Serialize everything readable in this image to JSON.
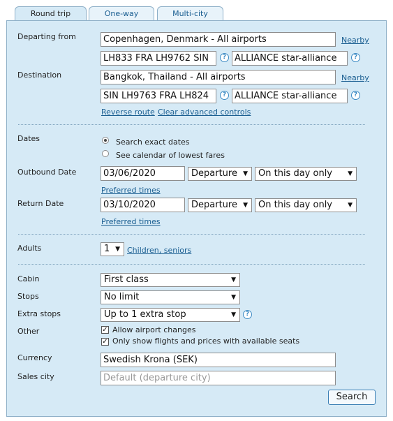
{
  "tabs": [
    {
      "label": "Round trip",
      "active": true
    },
    {
      "label": "One-way",
      "active": false
    },
    {
      "label": "Multi-city",
      "active": false
    }
  ],
  "departing": {
    "label": "Departing from",
    "value": "Copenhagen, Denmark - All airports",
    "nearby": "Nearby",
    "routing": "LH833 FRA LH9762 SIN",
    "extension": "ALLIANCE star-alliance"
  },
  "destination": {
    "label": "Destination",
    "value": "Bangkok, Thailand - All airports",
    "nearby": "Nearby",
    "routing": "SIN LH9763 FRA LH824",
    "extension": "ALLIANCE star-alliance"
  },
  "links": {
    "reverse": "Reverse route",
    "clear": "Clear advanced controls"
  },
  "dates": {
    "label": "Dates",
    "exact": "Search exact dates",
    "calendar": "See calendar of lowest fares",
    "selected": "exact"
  },
  "outbound": {
    "label": "Outbound Date",
    "date": "03/06/2020",
    "type": "Departure",
    "flex": "On this day only",
    "preferred": "Preferred times"
  },
  "return": {
    "label": "Return Date",
    "date": "03/10/2020",
    "type": "Departure",
    "flex": "On this day only",
    "preferred": "Preferred times"
  },
  "adults": {
    "label": "Adults",
    "value": "1",
    "link": "Children, seniors"
  },
  "cabin": {
    "label": "Cabin",
    "value": "First class"
  },
  "stops": {
    "label": "Stops",
    "value": "No limit"
  },
  "extra_stops": {
    "label": "Extra stops",
    "value": "Up to 1 extra stop"
  },
  "other": {
    "label": "Other",
    "allow_changes": "Allow airport changes",
    "available_seats": "Only show flights and prices with available seats",
    "allow_changes_checked": true,
    "available_seats_checked": true
  },
  "currency": {
    "label": "Currency",
    "value": "Swedish Krona (SEK)"
  },
  "sales_city": {
    "label": "Sales city",
    "placeholder": "Default (departure city)"
  },
  "search": {
    "label": "Search"
  },
  "icons": {
    "help": "help-icon",
    "dropdown": "chevron-down-icon",
    "check": "checkmark-icon"
  }
}
